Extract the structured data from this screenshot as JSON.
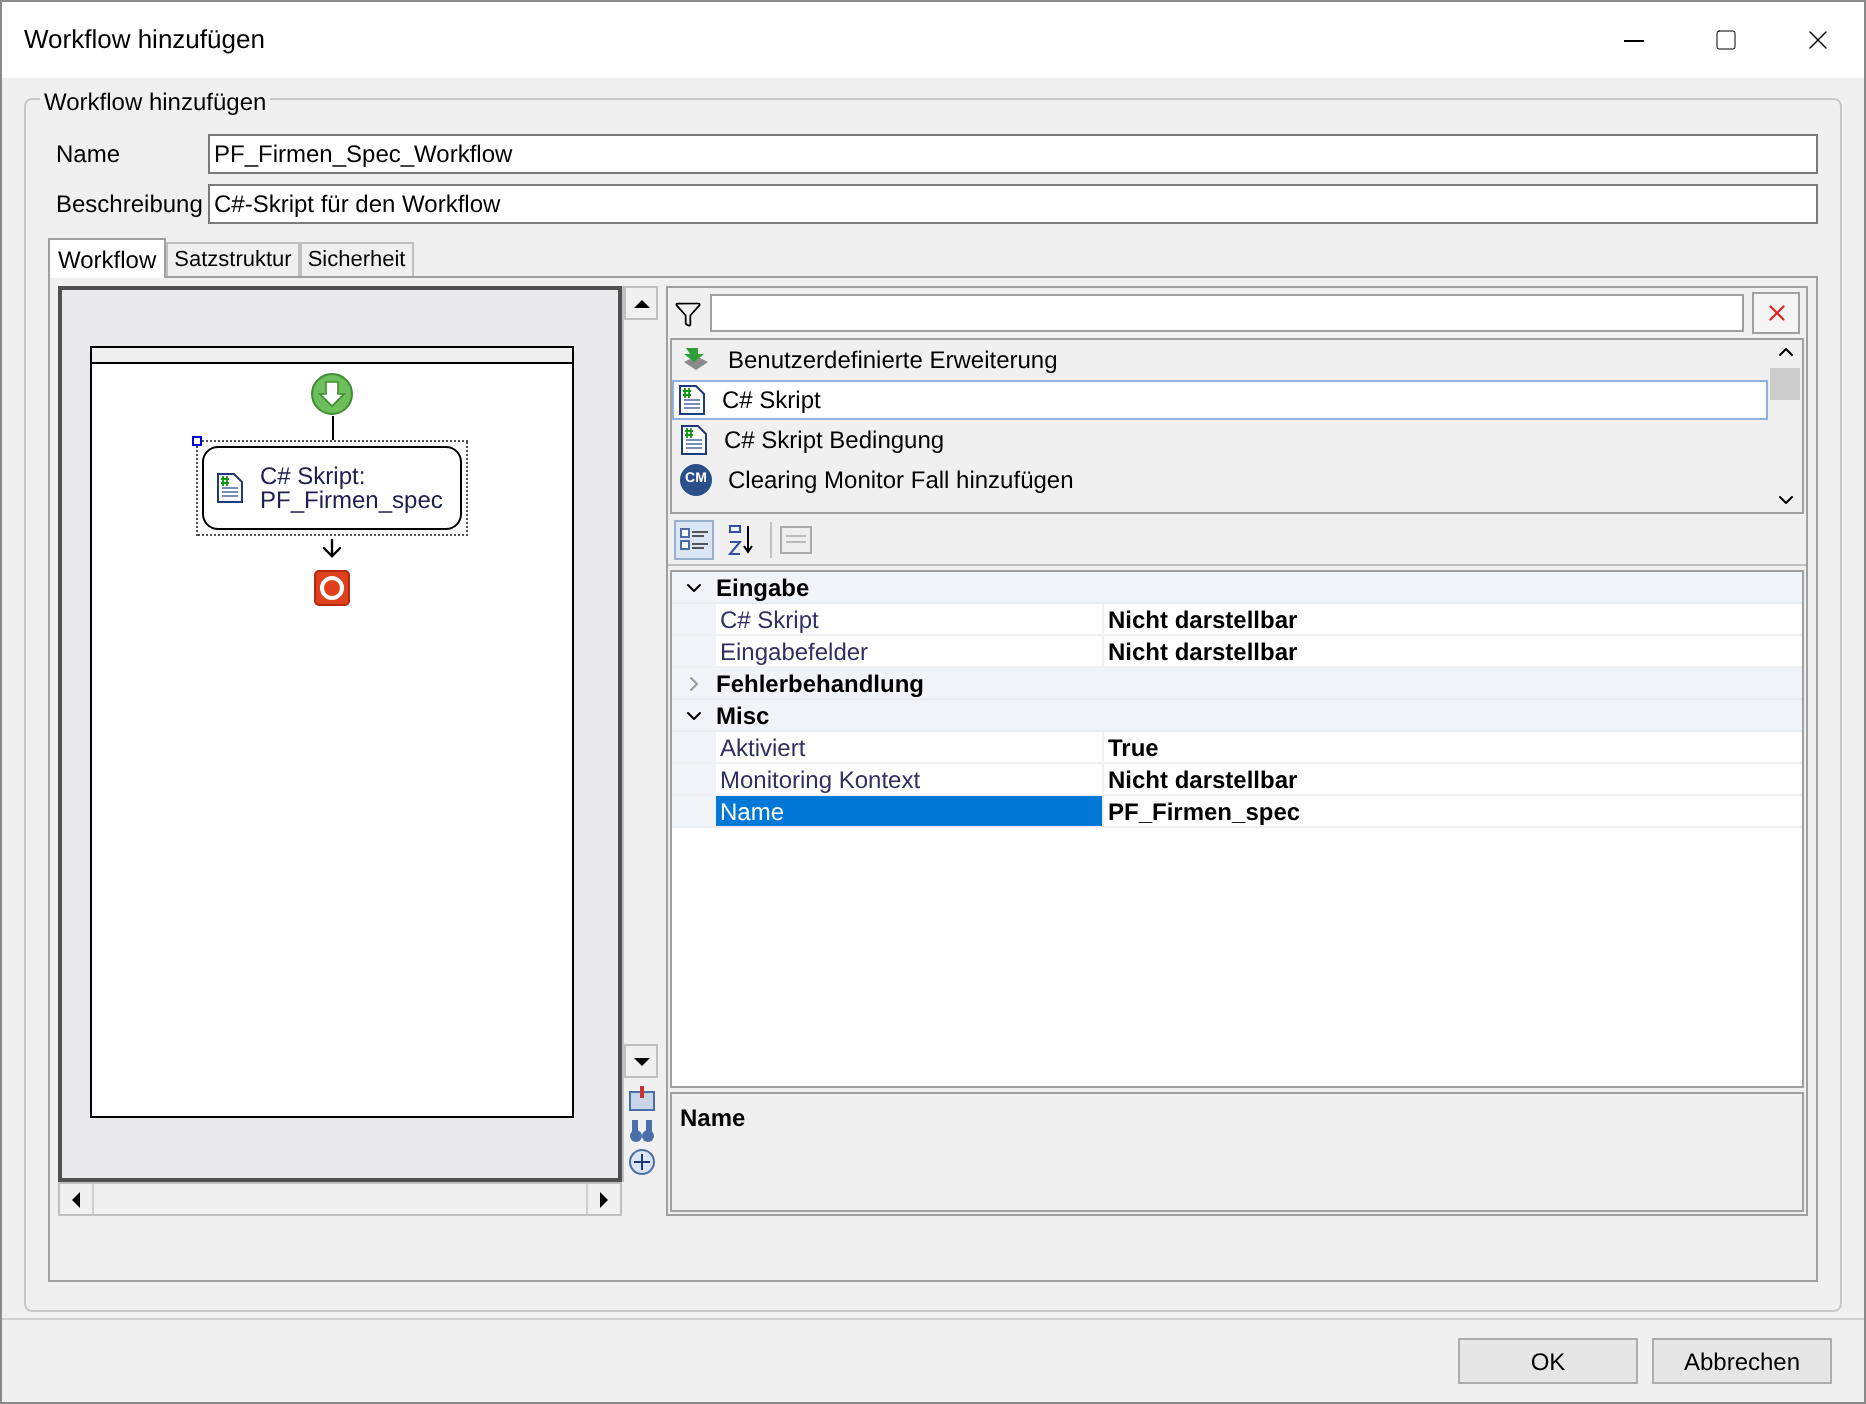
{
  "window": {
    "title": "Workflow hinzufügen"
  },
  "group": {
    "title": "Workflow hinzufügen"
  },
  "fields": [
    {
      "label": "Name",
      "value": "PF_Firmen_Spec_Workflow"
    },
    {
      "label": "Beschreibung",
      "value": "C#-Skript für den Workflow"
    }
  ],
  "tabs": [
    {
      "label": "Workflow",
      "selected": true
    },
    {
      "label": "Satzstruktur",
      "selected": false
    },
    {
      "label": "Sicherheit",
      "selected": false
    }
  ],
  "designer": {
    "activity": {
      "line_1": "C# Skript:",
      "line_2": "PF_Firmen_spec",
      "selected": true
    }
  },
  "toolbox": {
    "items": [
      {
        "kind": "extension",
        "label": "Benutzerdefinierte Erweiterung",
        "selected": false
      },
      {
        "kind": "script",
        "label": "C# Skript",
        "selected": true
      },
      {
        "kind": "script",
        "label": "C# Skript Bedingung",
        "selected": false
      },
      {
        "kind": "badge",
        "badge": "CM",
        "label": "Clearing Monitor Fall hinzufügen",
        "selected": false
      }
    ]
  },
  "properties": {
    "categories": [
      {
        "name": "Eingabe",
        "expanded": true,
        "rows": [
          {
            "name": "C# Skript",
            "value": "Nicht darstellbar",
            "selected": false
          },
          {
            "name": "Eingabefelder",
            "value": "Nicht darstellbar",
            "selected": false
          }
        ]
      },
      {
        "name": "Fehlerbehandlung",
        "expanded": false
      },
      {
        "name": "Misc",
        "expanded": true,
        "rows": [
          {
            "name": "Aktiviert",
            "value": "True",
            "selected": false
          },
          {
            "name": "Monitoring Kontext",
            "value": "Nicht darstellbar",
            "selected": false
          },
          {
            "name": "Name",
            "value": "PF_Firmen_spec",
            "selected": true
          }
        ]
      }
    ]
  },
  "description": {
    "title": "Name"
  },
  "buttons": [
    "OK",
    "Abbrechen"
  ]
}
